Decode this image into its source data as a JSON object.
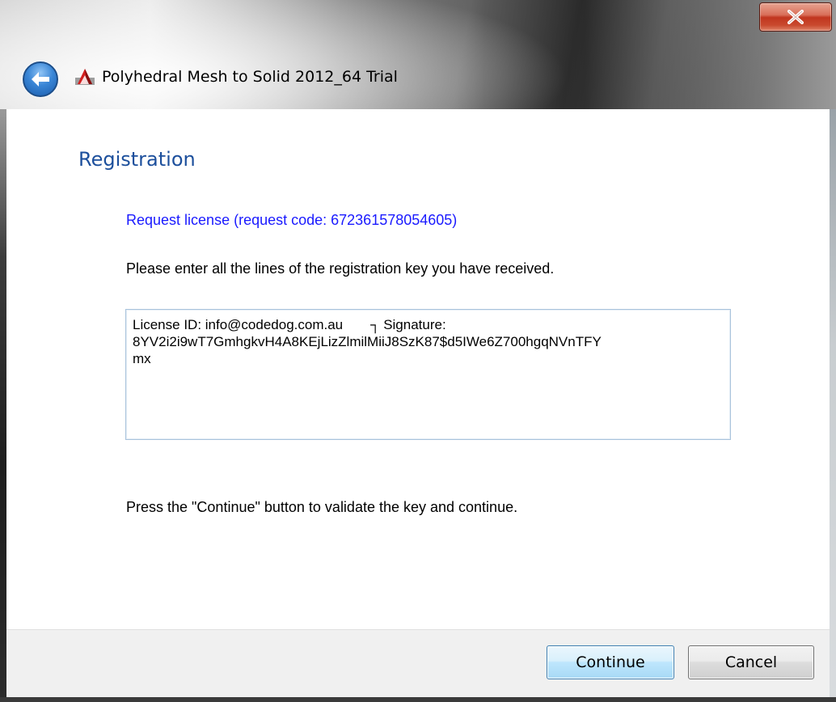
{
  "window": {
    "title": "Polyhedral Mesh to Solid 2012_64 Trial",
    "close_label": "x"
  },
  "page": {
    "heading": "Registration",
    "request_link": "Request license (request code: 672361578054605)",
    "instruction": "Please enter all the lines of the registration key you have received.",
    "key_field": {
      "line1_a": "License ID: info@codedog.com.au",
      "line1_sep": "┐",
      "line1_b": "Signature:",
      "line2": "8YV2i2i9wT7GmhgkvH4A8KEjLizZlmilMiiJ8SzK87$d5IWe6Z700hgqNVnTFY",
      "line3": "mx"
    },
    "hint": "Press the \"Continue\" button to validate the key and continue."
  },
  "footer": {
    "continue_label": "Continue",
    "cancel_label": "Cancel"
  },
  "icons": {
    "back": "back-arrow-icon",
    "app": "app-logo-icon",
    "close": "close-icon"
  },
  "colors": {
    "heading": "#1c4f9c",
    "link": "#1a1aff",
    "close_button": "#c1361f",
    "default_button_border": "#3c7fb1"
  }
}
